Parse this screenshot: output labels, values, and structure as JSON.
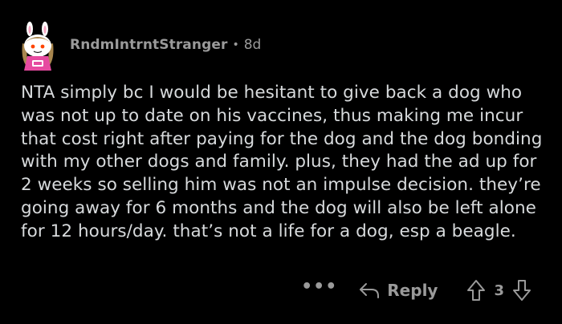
{
  "comment": {
    "author": "RndmIntrntStranger",
    "separator": "•",
    "age": "8d",
    "body": "NTA simply bc I would be hesitant to give back a dog who was not up to date on his vaccines, thus making me incur that cost right after paying for the dog and the dog bonding with my other dogs and family. plus, they had the ad up for 2 weeks so selling him was not an impulse decision. they’re going away for 6 months and the dog will also be left alone for 12 hours/day. that’s not a life for a dog, esp a beagle."
  },
  "actions": {
    "more_label": "•••",
    "reply_label": "Reply",
    "score": "3"
  },
  "icons": {
    "avatar": "snoo-avatar-icon",
    "reply": "reply-arrow-icon",
    "upvote": "upvote-arrow-icon",
    "downvote": "downvote-arrow-icon"
  },
  "colors": {
    "background": "#000000",
    "body_text": "#d7dadc",
    "meta_text": "#9a9a9a"
  }
}
